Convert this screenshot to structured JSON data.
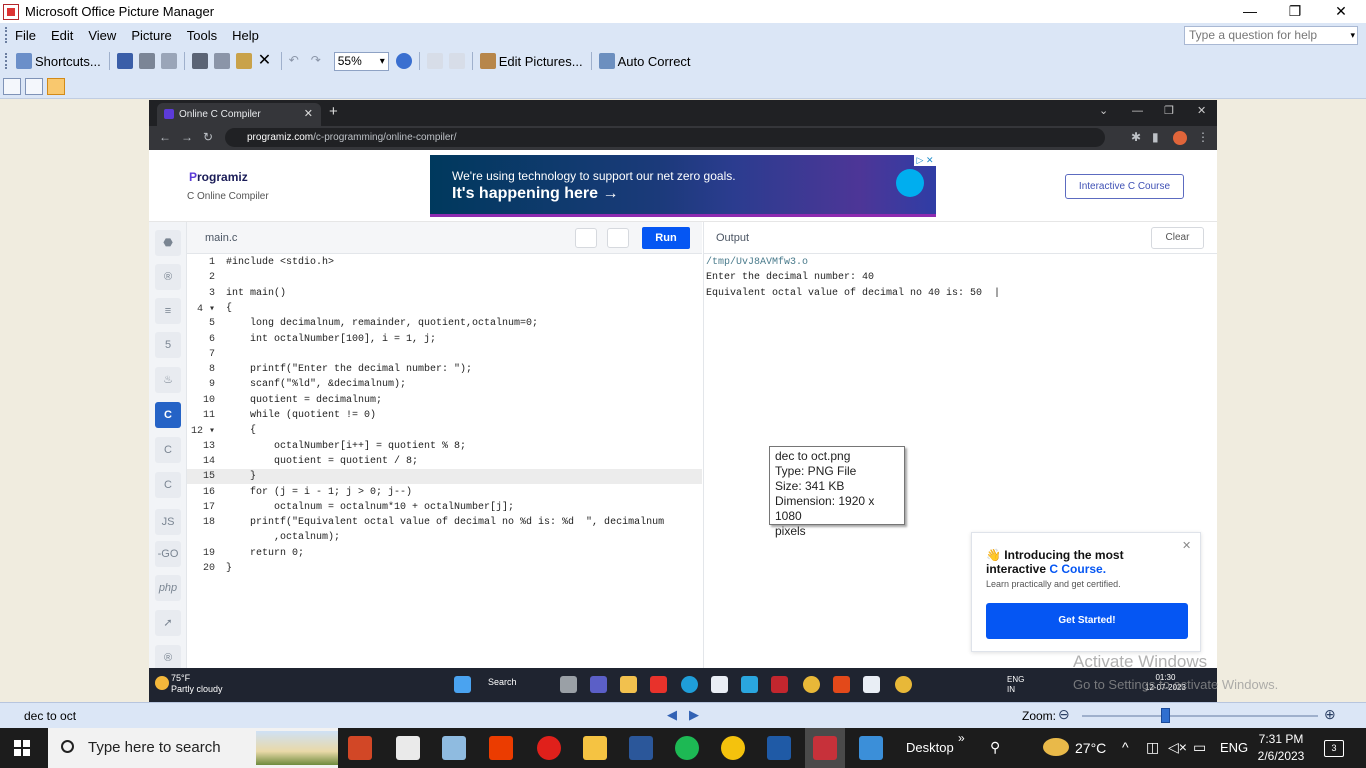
{
  "window": {
    "title": "Microsoft Office Picture Manager",
    "min": "—",
    "restore": "❐",
    "close": "✕"
  },
  "menu": {
    "file": "File",
    "edit": "Edit",
    "view": "View",
    "picture": "Picture",
    "tools": "Tools",
    "help": "Help"
  },
  "help_box": {
    "placeholder": "Type a question for help"
  },
  "toolbar": {
    "shortcuts": "Shortcuts...",
    "zoom": "55%",
    "edit_pictures": "Edit Pictures...",
    "auto_correct": "Auto Correct"
  },
  "browser": {
    "tab_title": "Online C Compiler",
    "url_host": "programiz.com",
    "url_path": "/c-programming/online-compiler/"
  },
  "page": {
    "logo": "rogramiz",
    "logo_p": "P",
    "logo_sub": "C Online Compiler",
    "ad_line1": "We're using technology to support our net zero goals.",
    "ad_line2": "It's happening here →",
    "ad_badge": "▷ ✕",
    "interactive_btn": "Interactive C Course"
  },
  "sidebar": {
    "js": "JS",
    "go": "-GO",
    "php": "php"
  },
  "editor": {
    "file": "main.c",
    "run": "Run",
    "lines": [
      {
        "n": "1",
        "code": "#include <stdio.h>"
      },
      {
        "n": "2",
        "code": ""
      },
      {
        "n": "3",
        "code": "int main()"
      },
      {
        "n": "4 ▾",
        "code": "{"
      },
      {
        "n": "5",
        "code": "    long decimalnum, remainder, quotient,octalnum=0;"
      },
      {
        "n": "6",
        "code": "    int octalNumber[100], i = 1, j;"
      },
      {
        "n": "7",
        "code": ""
      },
      {
        "n": "8",
        "code": "    printf(\"Enter the decimal number: \");"
      },
      {
        "n": "9",
        "code": "    scanf(\"%ld\", &decimalnum);"
      },
      {
        "n": "10",
        "code": "    quotient = decimalnum;"
      },
      {
        "n": "11",
        "code": "    while (quotient != 0)"
      },
      {
        "n": "12 ▾",
        "code": "    {"
      },
      {
        "n": "13",
        "code": "        octalNumber[i++] = quotient % 8;"
      },
      {
        "n": "14",
        "code": "        quotient = quotient / 8;"
      },
      {
        "n": "15",
        "code": "    }"
      },
      {
        "n": "16",
        "code": "    for (j = i - 1; j > 0; j--)"
      },
      {
        "n": "17",
        "code": "        octalnum = octalnum*10 + octalNumber[j];"
      },
      {
        "n": "18",
        "code": "    printf(\"Equivalent octal value of decimal no %d is: %d  \", decimalnum"
      },
      {
        "n": "",
        "code": "        ,octalnum);"
      },
      {
        "n": "19",
        "code": "    return 0;"
      },
      {
        "n": "20",
        "code": "}"
      }
    ]
  },
  "output": {
    "title": "Output",
    "clear": "Clear",
    "lines": [
      "/tmp/UvJ8AVMfw3.o",
      "Enter the decimal number: 40",
      "Equivalent octal value of decimal no 40 is: 50  |"
    ]
  },
  "tooltip": {
    "name": "dec to oct.png",
    "type": "Type: PNG File",
    "size": "Size: 341 KB",
    "dim": "Dimension: 1920 x 1080",
    "unit": "pixels"
  },
  "promo": {
    "line1": "👋 Introducing the most",
    "line2a": "interactive ",
    "line2b": "C Course.",
    "line3": "Learn practically and get certified.",
    "button": "Get Started!",
    "close": "✕"
  },
  "inner_taskbar": {
    "temp": "75°F",
    "weather": "Partly cloudy",
    "search": "Search",
    "lang1": "ENG",
    "lang2": "IN",
    "time": "01:30",
    "date": "12-07-2023"
  },
  "activate": {
    "line1": "Activate Windows",
    "line2": "Go to Settings to activate Windows."
  },
  "status": {
    "filename": "dec to oct",
    "zoom_label": "Zoom:",
    "prev": "◀",
    "next": "▶",
    "minus": "⊖",
    "plus": "⊕"
  },
  "taskbar": {
    "search": "Type here to search",
    "desktop": "Desktop",
    "chevron": "»",
    "temp": "27°C",
    "lang": "ENG",
    "time": "7:31 PM",
    "date": "2/6/2023",
    "notif": "3"
  }
}
